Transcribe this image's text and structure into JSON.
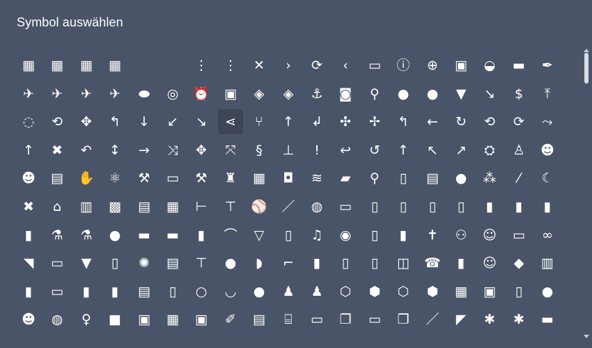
{
  "dialog": {
    "title": "Symbol auswählen",
    "selected_icon": "share-nodes-icon"
  },
  "icons": [
    [
      "chart-file-icon",
      "chart-file-icon",
      "chart-file-icon",
      "chart-file-icon",
      "",
      "",
      "ellipsis-vertical-thin-icon",
      "ellipsis-vertical-icon",
      "times-icon",
      "chevron-right-icon",
      "sync-icon",
      "chevron-left-icon",
      "glasses-3d-icon",
      "exclamation-circle-icon",
      "plus-circle-icon",
      "at-square-icon",
      "tape-icon",
      "bandage-icon",
      "pen-nib-icon"
    ],
    [
      "plane-icon",
      "plane-departure-icon",
      "plane-arrival-icon",
      "plane-landing-icon",
      "blimp-icon",
      "alarm-bell-icon",
      "alarm-clock-icon",
      "ambulance-icon",
      "box-open-icon",
      "box-icon",
      "anchor-icon",
      "android-icon",
      "antenna-icon",
      "apple-fruit-icon",
      "apple-logo-icon",
      "shirt-icon",
      "arrow-down-right-icon",
      "dollar-icon",
      "arrow-up-to-line-icon"
    ],
    [
      "circle-arrow-icon",
      "rotate-icon",
      "move-icon",
      "arrow-turn-up-left-icon",
      "arrow-down-icon",
      "arrow-down-left-icon",
      "arrow-down-right-icon",
      "share-nodes-icon",
      "split-icon",
      "long-arrow-up-icon",
      "turn-down-left-icon",
      "arrows-in-icon",
      "compress-icon",
      "turn-left-icon",
      "arrow-left-icon",
      "redo-icon",
      "repeat-icon",
      "repeat-alt-icon",
      "shuffle-forward-icon"
    ],
    [
      "long-arrow-up-icon",
      "cross-arrows-icon",
      "undo-icon",
      "split-left-icon",
      "arrow-right-icon",
      "shuffle-icon",
      "expand-icon",
      "compress-alt-icon",
      "s-arrow-icon",
      "split-up-icon",
      "exclamation-icon",
      "reply-icon",
      "rotate-left-icon",
      "arrow-up-icon",
      "arrow-up-left-icon",
      "arrow-up-right-icon",
      "joystick-icon",
      "baby-icon",
      "astronaut-icon"
    ],
    [
      "user-badge-icon",
      "calculator-icon",
      "hands-praying-icon",
      "atom-icon",
      "gavel-icon",
      "cassette-icon",
      "axe-icon",
      "baby-bottle-icon",
      "boxes-icon",
      "backpack-icon",
      "bacon-icon",
      "bandaid-icon",
      "badminton-icon",
      "receipt-icon",
      "register-icon",
      "balloon-icon",
      "balloons-icon",
      "baguette-icon",
      "banana-icon"
    ],
    [
      "bone-cross-icon",
      "bank-icon",
      "barcode-icon",
      "barcode-scanner-icon",
      "film-icon",
      "building-icon",
      "barrier-icon",
      "crane-icon",
      "baseball-icon",
      "baseball-bat-icon",
      "basketball-icon",
      "basketball-hoop-icon",
      "battery-bolt-icon",
      "battery-exclamation-icon",
      "battery-empty-icon",
      "battery-quarter-icon",
      "battery-half-icon",
      "battery-three-quarters-icon",
      "battery-full-icon"
    ],
    [
      "battery-icon",
      "flask-icon",
      "beaker-icon",
      "bear-icon",
      "bed-icon",
      "bed-alt-icon",
      "beer-bottle-icon",
      "bridge-icon",
      "wine-glass-icon",
      "beer-mug-icon",
      "bell-icon",
      "bell-ring-icon",
      "toilet-paper-icon",
      "cup-icon",
      "bible-icon",
      "bicycle-icon",
      "user-headset-icon",
      "billboard-icon",
      "binoculars-icon"
    ],
    [
      "bird-icon",
      "blackboard-icon",
      "blender-icon",
      "clipboard-icon",
      "virus-icon",
      "calendar-icon",
      "bolt-screw-icon",
      "bomb-icon",
      "bone-biscuit-icon",
      "bone-icon",
      "book-icon",
      "book-bookmark-icon",
      "book-alt-icon",
      "book-open-icon",
      "address-book-icon",
      "notebook-icon",
      "bowling-pin-user-icon",
      "bottle-icon",
      "books-icon"
    ],
    [
      "files-icon",
      "boombox-icon",
      "jar-icon",
      "bottle-tall-icon",
      "crate-icon",
      "jar-label-icon",
      "ring-icon",
      "bowl-icon",
      "bowling-ball-icon",
      "bowling-pin-icon",
      "bowling-pins-icon",
      "cube-icon",
      "box-full-icon",
      "box-open-alt-icon",
      "box-check-icon",
      "box-dollar-icon",
      "box-tissue-icon",
      "box-archive-icon",
      "boxing-glove-icon"
    ],
    [
      "brain-user-icon",
      "brain-icon",
      "toothbrush-icon",
      "square-icon",
      "square-dashed-icon",
      "squares-icon",
      "dashed-square-icon",
      "pen-ruler-icon",
      "brick-wall-icon",
      "bridge-alt-icon",
      "briefcase-icon",
      "copy-icon",
      "suitcase-medical-icon",
      "paste-icon",
      "paintbrush-icon",
      "broom-icon",
      "bug-icon",
      "beetle-icon",
      "bread-icon"
    ]
  ]
}
